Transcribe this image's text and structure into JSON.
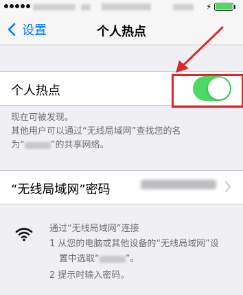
{
  "nav": {
    "back_label": "设置",
    "title": "个人热点"
  },
  "hotspot": {
    "label": "个人热点",
    "enabled": true,
    "toggle_color": "#4cd964"
  },
  "discoverable": {
    "status": "现在可被发现。",
    "line2": "其他用户可以通过“无线局域网”查找您的名",
    "line3_prefix": "为“",
    "line3_suffix": "”的共享网络。"
  },
  "wifi_password": {
    "label": "“无线局域网”密码"
  },
  "instructions": {
    "heading": "通过“无线局域网”连接",
    "step1_line1": "1 从您的电脑或其他设备的“无线局域网”设",
    "step1_line2_prefix": "置中选取“",
    "step1_line2_suffix": "”。",
    "step2": "2 提示时输入密码。"
  },
  "colors": {
    "accent": "#007aff",
    "annotation": "#e0262a",
    "battery": "#4cd964"
  },
  "icons": {
    "back": "chevron-left-icon",
    "wifi": "wifi-icon",
    "disclosure": "chevron-right-icon"
  }
}
